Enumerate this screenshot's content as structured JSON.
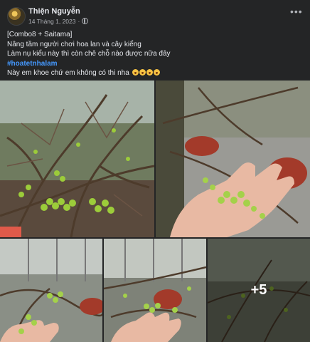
{
  "post": {
    "author": "Thiện Nguyễn",
    "date": "14 Tháng 1, 2023",
    "separator": "·",
    "more_icon": "more-horizontal-icon",
    "privacy_icon": "globe-icon"
  },
  "caption": {
    "line1": "[Combo8 + Saitama]",
    "line2": "Nâng tầm người chơi hoa lan và cây kiểng",
    "line3": "Làm nụ kiểu này thì còn chê chỗ nào được nữa đây",
    "hashtag": "#hoatetnhalam",
    "line5": "Này em khoe chứ em không có thi nha"
  },
  "gallery": {
    "more_count": "+5",
    "photo_count_visible": 5
  },
  "colors": {
    "background": "#242526",
    "text": "#e4e6eb",
    "secondary_text": "#b0b3b8",
    "hashtag": "#4599ff"
  }
}
